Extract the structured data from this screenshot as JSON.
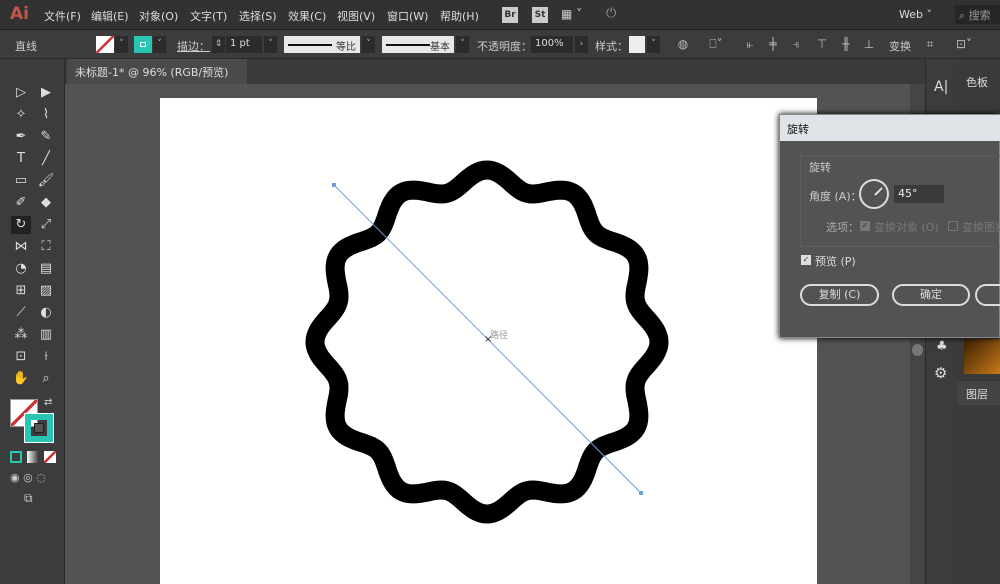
{
  "app": {
    "logo": "Ai"
  },
  "menu": [
    "文件(F)",
    "编辑(E)",
    "对象(O)",
    "文字(T)",
    "选择(S)",
    "效果(C)",
    "视图(V)",
    "窗口(W)",
    "帮助(H)"
  ],
  "appbar": {
    "bridge": "Br",
    "stock": "St",
    "workspace": "Web",
    "search_placeholder": "搜索"
  },
  "control": {
    "object_type": "直线",
    "stroke_label": "描边：",
    "stroke_weight": "1 pt",
    "profile": "等比",
    "brush": "基本",
    "opacity_label": "不透明度：",
    "opacity": "100%",
    "style_label": "样式：",
    "transform": "变换"
  },
  "document": {
    "tab": "未标题-1* @ 96% (RGB/预览)",
    "close": "×",
    "path_label": "路径"
  },
  "colors": {
    "fill": "none",
    "stroke": "#2ac6b4",
    "accent": "#2ac6b4",
    "shape": "#000000",
    "guide": "#6f9fd8"
  },
  "panels": {
    "swatches": "色板",
    "layers": "图层"
  },
  "dialog": {
    "title": "旋转",
    "group": "旋转",
    "angle_label": "角度 (A)：",
    "angle": "45°",
    "options_label": "选项：",
    "transform_objects": "变换对象 (O)",
    "transform_patterns": "变换图案",
    "preview": "预览 (P)",
    "preview_checked": true,
    "copy": "复制 (C)",
    "ok": "确定"
  }
}
